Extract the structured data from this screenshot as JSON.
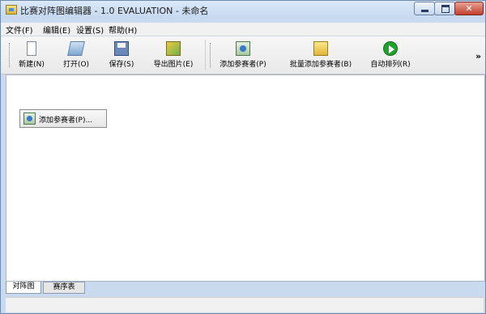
{
  "window": {
    "title": "比赛对阵图编辑器 - 1.0 EVALUATION - 未命名"
  },
  "menu": [
    {
      "label": "文件(F)"
    },
    {
      "label": "编辑(E)"
    },
    {
      "label": "设置(S)"
    },
    {
      "label": "帮助(H)"
    }
  ],
  "toolbar": {
    "new_label": "新建(N)",
    "open_label": "打开(O)",
    "save_label": "保存(S)",
    "export_label": "导出图片(E)",
    "add_participant_label": "添加参赛者(P)",
    "batch_add_label": "批量添加参赛者(B)",
    "auto_arrange_label": "自动排列(R)",
    "overflow_label": "»"
  },
  "canvas": {
    "add_participant_button": "添加参赛者(P)..."
  },
  "tabs": [
    {
      "label": "对阵图",
      "active": true
    },
    {
      "label": "赛序表",
      "active": false
    }
  ],
  "colors": {
    "titlebar": "#c5d8ef",
    "close_button": "#c0402d",
    "auto_arrange_icon": "#1fa12c"
  },
  "icons": {
    "new": "new-document-icon",
    "open": "open-folder-icon",
    "save": "floppy-disk-icon",
    "export": "export-image-icon",
    "add_participant": "add-participant-icon",
    "batch_add": "batch-add-folder-icon",
    "auto_arrange": "play-icon"
  }
}
